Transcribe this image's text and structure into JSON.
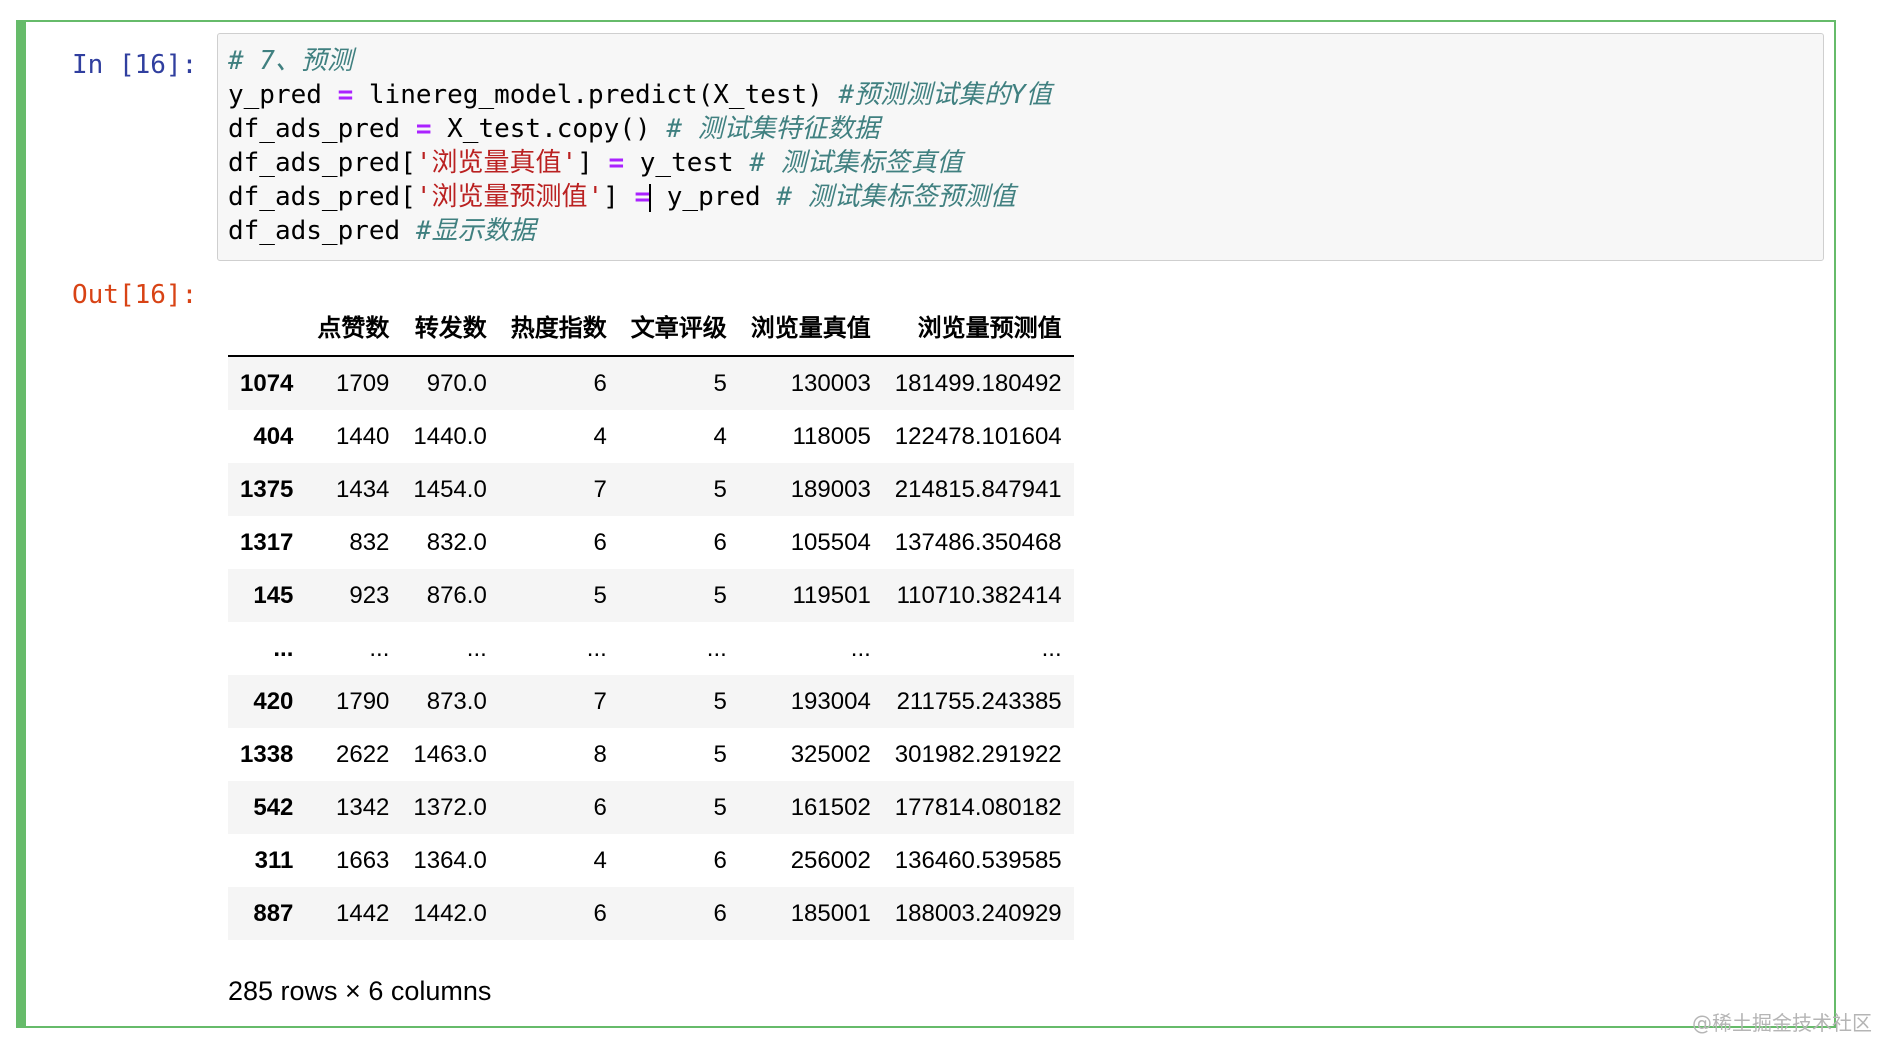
{
  "cell": {
    "in_prompt": "In [16]:",
    "out_prompt": "Out[16]:",
    "code": {
      "line1_comment": "# 7、预测",
      "line2_a": "y_pred ",
      "line2_op": "=",
      "line2_b": " linereg_model.predict(X_test) ",
      "line2_comment": "#预测测试集的Y值",
      "line3_a": "df_ads_pred ",
      "line3_op": "=",
      "line3_b": " X_test.copy() ",
      "line3_comment": "# 测试集特征数据",
      "line4_a": "df_ads_pred[",
      "line4_str": "'浏览量真值'",
      "line4_b": "] ",
      "line4_op": "=",
      "line4_c": " y_test ",
      "line4_comment": "# 测试集标签真值",
      "line5_a": "df_ads_pred[",
      "line5_str": "'浏览量预测值'",
      "line5_b": "] ",
      "line5_op": "=",
      "line5_c": " y_pred ",
      "line5_comment": "# 测试集标签预测值",
      "line6_a": "df_ads_pred ",
      "line6_comment": "#显示数据"
    }
  },
  "table": {
    "columns": [
      "",
      "点赞数",
      "转发数",
      "热度指数",
      "文章评级",
      "浏览量真值",
      "浏览量预测值"
    ],
    "rows": [
      [
        "1074",
        "1709",
        "970.0",
        "6",
        "5",
        "130003",
        "181499.180492"
      ],
      [
        "404",
        "1440",
        "1440.0",
        "4",
        "4",
        "118005",
        "122478.101604"
      ],
      [
        "1375",
        "1434",
        "1454.0",
        "7",
        "5",
        "189003",
        "214815.847941"
      ],
      [
        "1317",
        "832",
        "832.0",
        "6",
        "6",
        "105504",
        "137486.350468"
      ],
      [
        "145",
        "923",
        "876.0",
        "5",
        "5",
        "119501",
        "110710.382414"
      ],
      [
        "...",
        "...",
        "...",
        "...",
        "...",
        "...",
        "..."
      ],
      [
        "420",
        "1790",
        "873.0",
        "7",
        "5",
        "193004",
        "211755.243385"
      ],
      [
        "1338",
        "2622",
        "1463.0",
        "8",
        "5",
        "325002",
        "301982.291922"
      ],
      [
        "542",
        "1342",
        "1372.0",
        "6",
        "5",
        "161502",
        "177814.080182"
      ],
      [
        "311",
        "1663",
        "1364.0",
        "4",
        "6",
        "256002",
        "136460.539585"
      ],
      [
        "887",
        "1442",
        "1442.0",
        "6",
        "6",
        "185001",
        "188003.240929"
      ]
    ],
    "shape_note": "285 rows × 6 columns"
  },
  "watermark": "@稀土掘金技术社区",
  "colors": {
    "cell_border": "#66bb6a",
    "in_prompt": "#303f9f",
    "out_prompt": "#d84315",
    "comment": "#408080",
    "operator": "#aa22ff",
    "string": "#ba2121"
  }
}
